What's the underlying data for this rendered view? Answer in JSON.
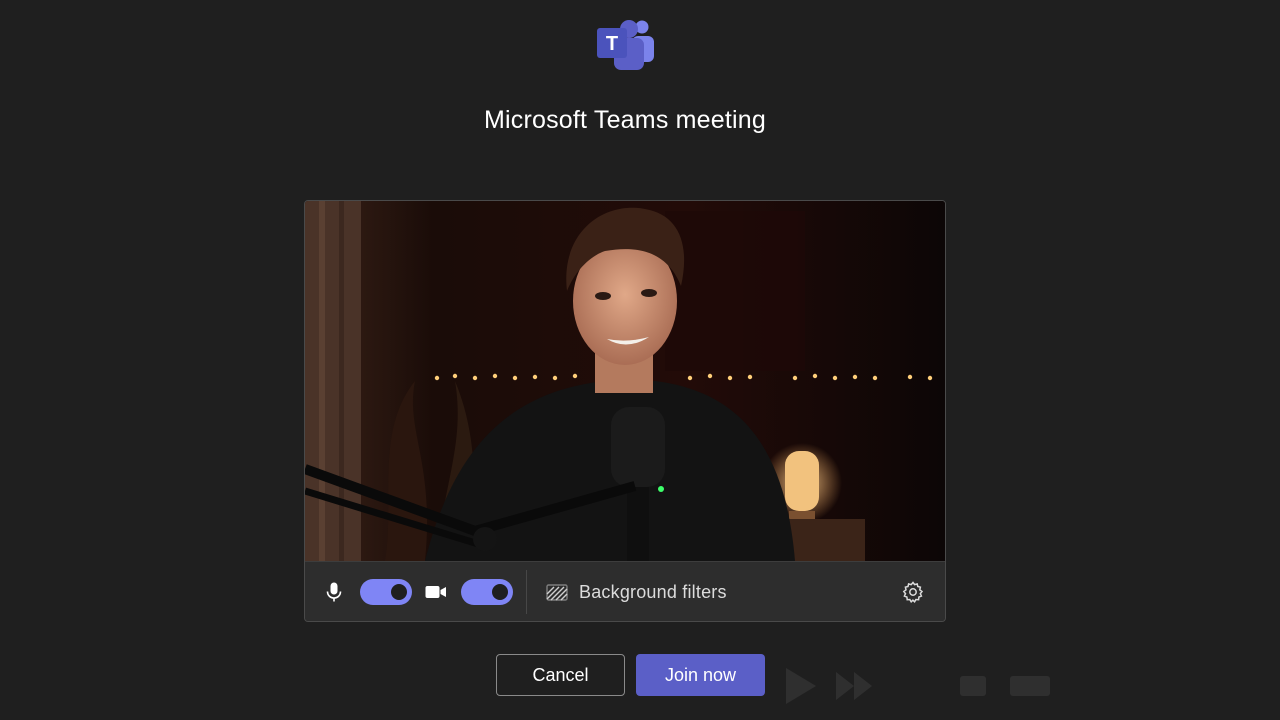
{
  "app": {
    "logo": "microsoft-teams-logo",
    "logo_letter": "T",
    "brand_color": "#5b5fc7"
  },
  "header": {
    "title": "Microsoft Teams meeting"
  },
  "preview": {
    "camera_feed": "self-view-camera-feed",
    "controls": {
      "mic_icon": "microphone-icon",
      "mic_on": true,
      "camera_icon": "video-camera-icon",
      "camera_on": true,
      "toggle_color": "#7f85f5",
      "background_filters_icon": "background-filters-icon",
      "background_filters_label": "Background filters",
      "settings_icon": "gear-icon"
    }
  },
  "actions": {
    "cancel_label": "Cancel",
    "join_label": "Join now"
  }
}
